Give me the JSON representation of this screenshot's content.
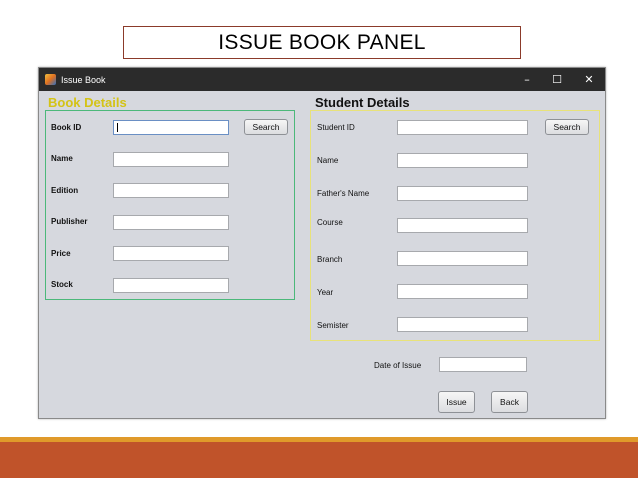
{
  "slide": {
    "title": "ISSUE BOOK PANEL"
  },
  "window": {
    "title": "Issue Book",
    "minimize": "–",
    "maximize": "☐",
    "close": "✕"
  },
  "book_details": {
    "heading": "Book Details",
    "fields": [
      {
        "label": "Book ID",
        "value": ""
      },
      {
        "label": "Name",
        "value": ""
      },
      {
        "label": "Edition",
        "value": ""
      },
      {
        "label": "Publisher",
        "value": ""
      },
      {
        "label": "Price",
        "value": ""
      },
      {
        "label": "Stock",
        "value": ""
      }
    ],
    "search_label": "Search"
  },
  "student_details": {
    "heading": "Student Details",
    "fields": [
      {
        "label": "Student ID",
        "value": ""
      },
      {
        "label": "Name",
        "value": ""
      },
      {
        "label": "Father's Name",
        "value": ""
      },
      {
        "label": "Course",
        "value": ""
      },
      {
        "label": "Branch",
        "value": ""
      },
      {
        "label": "Year",
        "value": ""
      },
      {
        "label": "Semister",
        "value": ""
      }
    ],
    "search_label": "Search"
  },
  "issue": {
    "date_label": "Date of Issue",
    "date_value": "",
    "issue_label": "Issue",
    "back_label": "Back"
  },
  "colors": {
    "book_heading": "#d4c316",
    "book_border": "#4cb87a",
    "student_border": "#e8e27a",
    "window_bg": "#d6d8de",
    "titlebar": "#2b2b2b",
    "footer_bar": "#c0532a",
    "footer_line": "#e09a2a"
  }
}
